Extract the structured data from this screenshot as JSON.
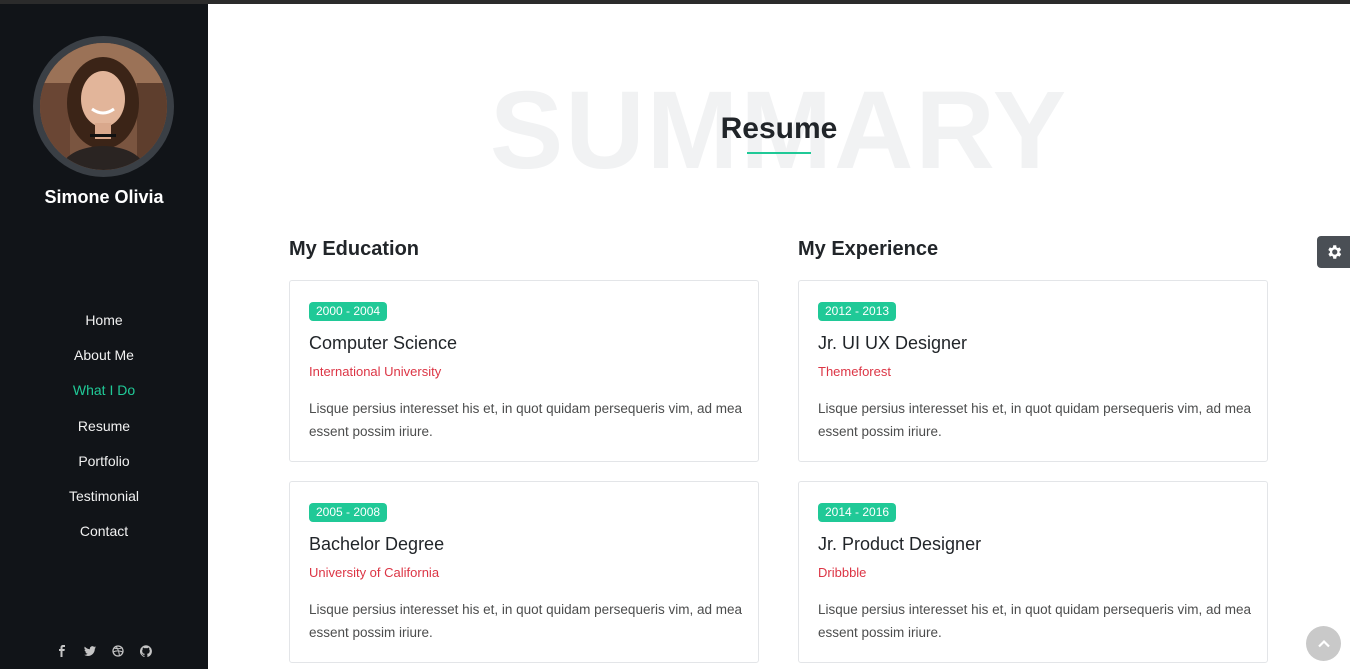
{
  "sidebar": {
    "name": "Simone Olivia",
    "nav": [
      "Home",
      "About Me",
      "What I Do",
      "Resume",
      "Portfolio",
      "Testimonial",
      "Contact"
    ],
    "active_index": 2,
    "social_icons": [
      "facebook-icon",
      "twitter-icon",
      "dribbble-icon",
      "github-icon"
    ]
  },
  "header": {
    "watermark": "SUMMARY",
    "title": "Resume"
  },
  "education": {
    "heading": "My Education",
    "items": [
      {
        "years": "2000 - 2004",
        "title": "Computer Science",
        "place": "International University",
        "text": "Lisque persius interesset his et, in quot quidam persequeris vim, ad mea essent possim iriure."
      },
      {
        "years": "2005 - 2008",
        "title": "Bachelor Degree",
        "place": "University of California",
        "text": "Lisque persius interesset his et, in quot quidam persequeris vim, ad mea essent possim iriure."
      }
    ]
  },
  "experience": {
    "heading": "My Experience",
    "items": [
      {
        "years": "2012 - 2013",
        "title": "Jr. UI UX Designer",
        "place": "Themeforest",
        "text": "Lisque persius interesset his et, in quot quidam persequeris vim, ad mea essent possim iriure."
      },
      {
        "years": "2014 - 2016",
        "title": "Jr. Product Designer",
        "place": "Dribbble",
        "text": "Lisque persius interesset his et, in quot quidam persequeris vim, ad mea essent possim iriure."
      }
    ]
  },
  "colors": {
    "accent": "#20c997",
    "sidebar_bg": "#111418",
    "place_text": "#dc3545"
  },
  "controls": {
    "settings_icon": "gear-icon",
    "back_to_top_icon": "chevron-up-icon"
  }
}
